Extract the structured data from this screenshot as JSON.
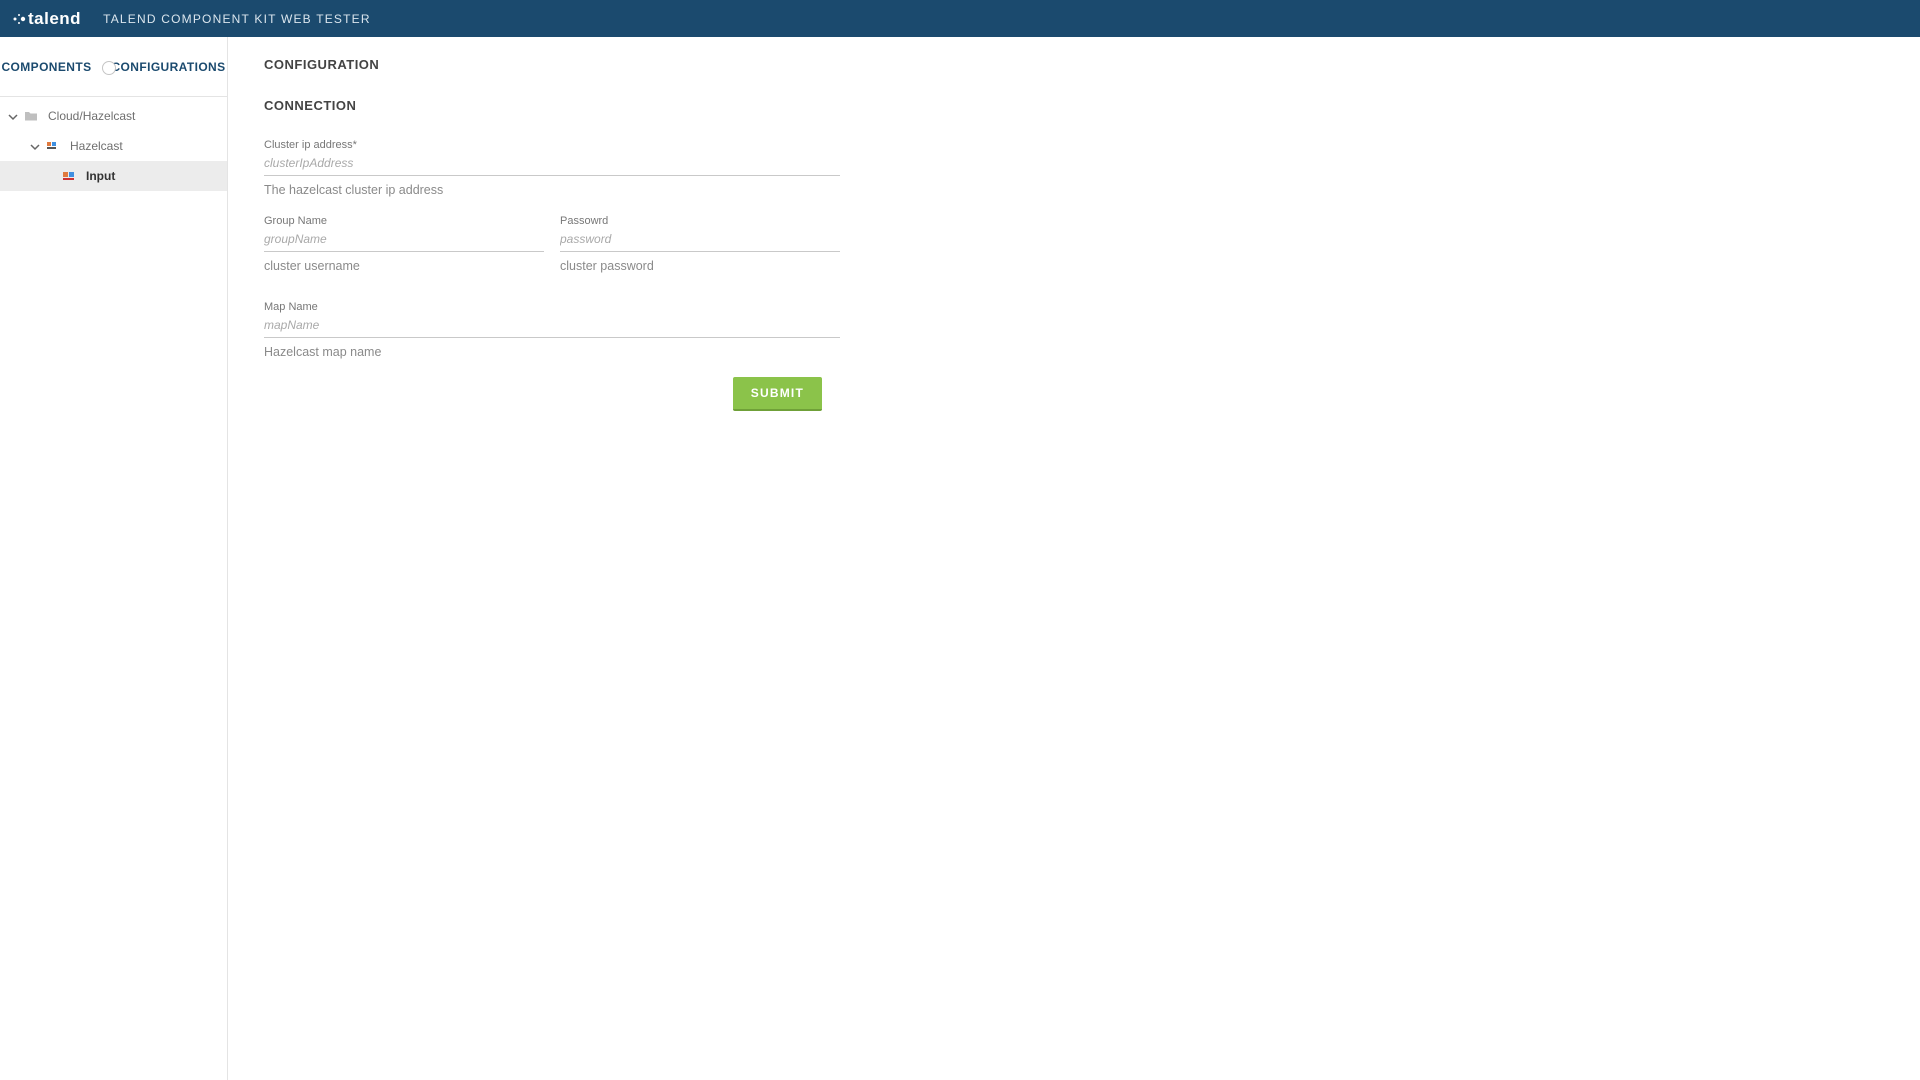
{
  "header": {
    "brand": "talend",
    "title": "TALEND COMPONENT KIT WEB TESTER"
  },
  "sidebar": {
    "tabs": {
      "left": "COMPONENTS",
      "right": "CONFIGURATIONS"
    },
    "tree": {
      "root_label": "Cloud/Hazelcast",
      "child_label": "Hazelcast",
      "leaf_label": "Input"
    }
  },
  "form": {
    "section_title": "CONFIGURATION",
    "subsection_title": "CONNECTION",
    "cluster_ip": {
      "label": "Cluster ip address*",
      "placeholder": "clusterIpAddress",
      "help": "The hazelcast cluster ip address"
    },
    "group_name": {
      "label": "Group Name",
      "placeholder": "groupName",
      "help": "cluster username"
    },
    "password": {
      "label": "Passowrd",
      "placeholder": "password",
      "help": "cluster password"
    },
    "map_name": {
      "label": "Map Name",
      "placeholder": "mapName",
      "help": "Hazelcast map name"
    },
    "submit_label": "SUBMIT"
  }
}
